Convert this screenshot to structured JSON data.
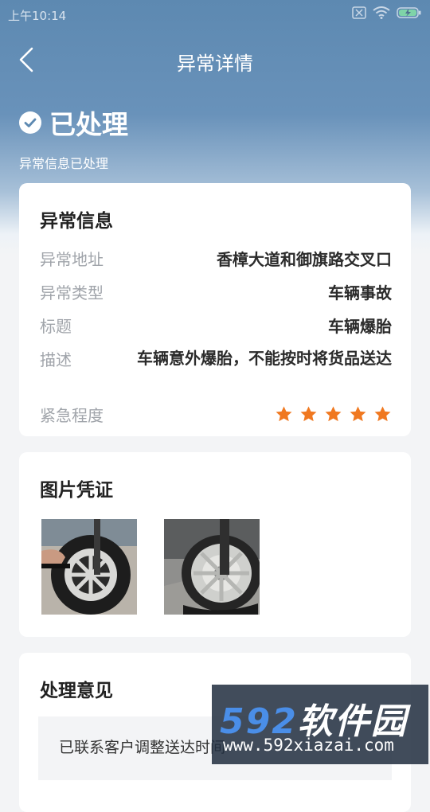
{
  "status_bar": {
    "time": "上午10:14"
  },
  "nav": {
    "title": "异常详情"
  },
  "status": {
    "label": "已处理",
    "subtitle": "异常信息已处理"
  },
  "exception_info": {
    "title": "异常信息",
    "rows": [
      {
        "key": "异常地址",
        "value": "香樟大道和御旗路交叉口"
      },
      {
        "key": "异常类型",
        "value": "车辆事故"
      },
      {
        "key": "标题",
        "value": "车辆爆胎"
      },
      {
        "key": "描述",
        "value": "车辆意外爆胎，不能按时将货品送达"
      }
    ],
    "urgency": {
      "key": "紧急程度",
      "rating": 5,
      "max": 5
    }
  },
  "evidence": {
    "title": "图片凭证"
  },
  "opinion": {
    "title": "处理意见",
    "text": "已联系客户调整送达时间"
  },
  "watermark": {
    "brand_num": "592",
    "brand_text": "软件园",
    "url": "www.592xiazai.com"
  },
  "colors": {
    "header_blue": "#5d89b1",
    "star_orange": "#f07820"
  }
}
